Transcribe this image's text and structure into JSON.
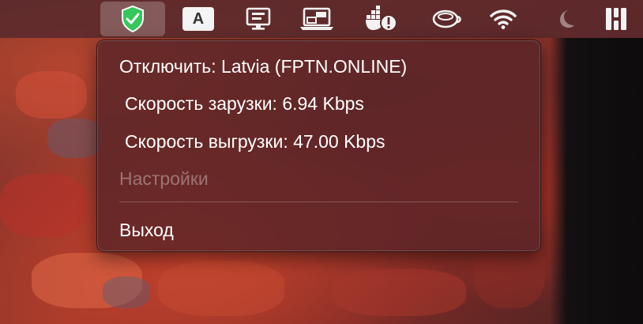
{
  "menubar": {
    "items": [
      {
        "icon": "vpn-shield-icon",
        "active": true
      },
      {
        "icon": "input-source-a-icon",
        "text": "A"
      },
      {
        "icon": "monitor-icon"
      },
      {
        "icon": "screen-mirroring-icon"
      },
      {
        "icon": "docker-warning-icon"
      },
      {
        "icon": "coffee-cup-icon"
      },
      {
        "icon": "wifi-icon"
      },
      {
        "icon": "moon-icon"
      },
      {
        "icon": "bartender-icon"
      }
    ]
  },
  "menu": {
    "disconnect": "Отключить: Latvia (FPTN.ONLINE)",
    "download": "Скорость зарузки: 6.94 Kbps",
    "upload": "Скорость выгрузки: 47.00 Kbps",
    "settings": "Настройки",
    "quit": "Выход"
  },
  "colors": {
    "shield": "#34c759",
    "menu_bg": "#58242a"
  }
}
